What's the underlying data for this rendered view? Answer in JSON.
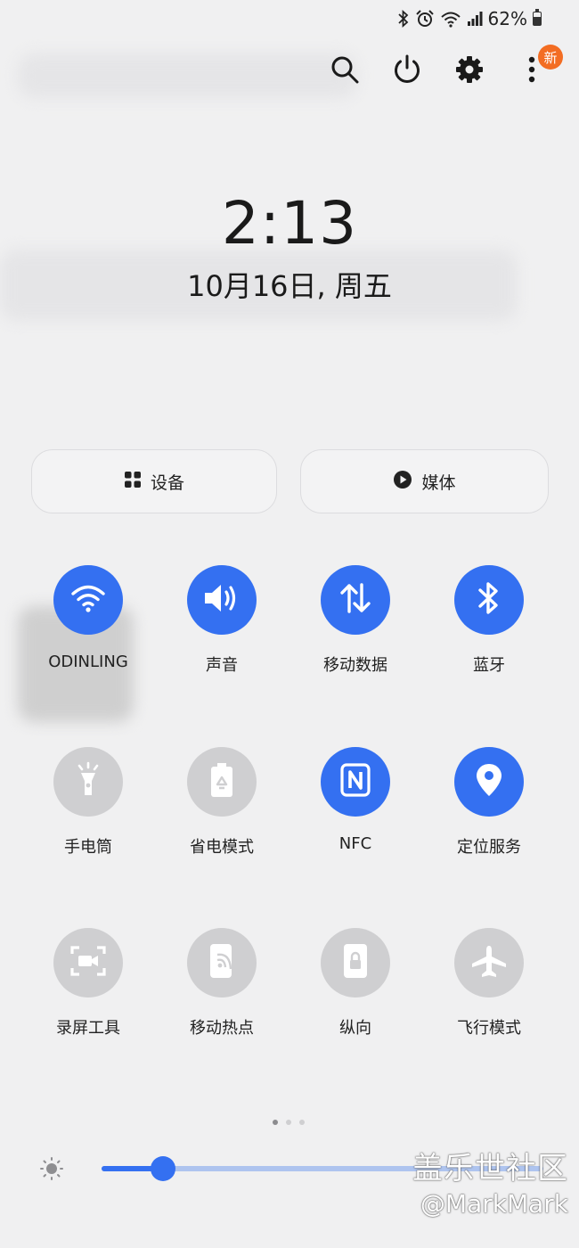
{
  "status_bar": {
    "battery": "62%",
    "battery_level": 0.62,
    "icons": [
      "bluetooth-icon",
      "alarm-icon",
      "wifi-icon",
      "signal-icon",
      "battery-icon"
    ]
  },
  "top_actions": {
    "icons": [
      "search-icon",
      "power-icon",
      "gear-icon",
      "more-vertical-icon"
    ],
    "new_badge": "新"
  },
  "clock": {
    "time": "2:13",
    "date": "10月16日, 周五"
  },
  "buttons": {
    "devices": "设备",
    "media": "媒体"
  },
  "tiles": [
    {
      "label": "ODINLING",
      "icon": "wifi-icon",
      "active": true
    },
    {
      "label": "声音",
      "icon": "sound-icon",
      "active": true
    },
    {
      "label": "移动数据",
      "icon": "mobile-data-icon",
      "active": true
    },
    {
      "label": "蓝牙",
      "icon": "bluetooth-icon",
      "active": true
    },
    {
      "label": "手电筒",
      "icon": "flashlight-icon",
      "active": false
    },
    {
      "label": "省电模式",
      "icon": "power-saving-icon",
      "active": false
    },
    {
      "label": "NFC",
      "icon": "nfc-icon",
      "active": true
    },
    {
      "label": "定位服务",
      "icon": "location-icon",
      "active": true
    },
    {
      "label": "录屏工具",
      "icon": "screen-recorder-icon",
      "active": false
    },
    {
      "label": "移动热点",
      "icon": "hotspot-icon",
      "active": false
    },
    {
      "label": "纵向",
      "icon": "portrait-lock-icon",
      "active": false
    },
    {
      "label": "飞行模式",
      "icon": "airplane-icon",
      "active": false
    }
  ],
  "pagination": {
    "pages": 3,
    "current": 1
  },
  "brightness": {
    "level": 0.14
  },
  "watermark": {
    "line1": "盖乐世社区",
    "line2": "@MarkMark"
  },
  "colors": {
    "accent": "#3470f1",
    "inactive": "#cfcfd1",
    "badge": "#f36d23",
    "background": "#f0f0f1"
  }
}
